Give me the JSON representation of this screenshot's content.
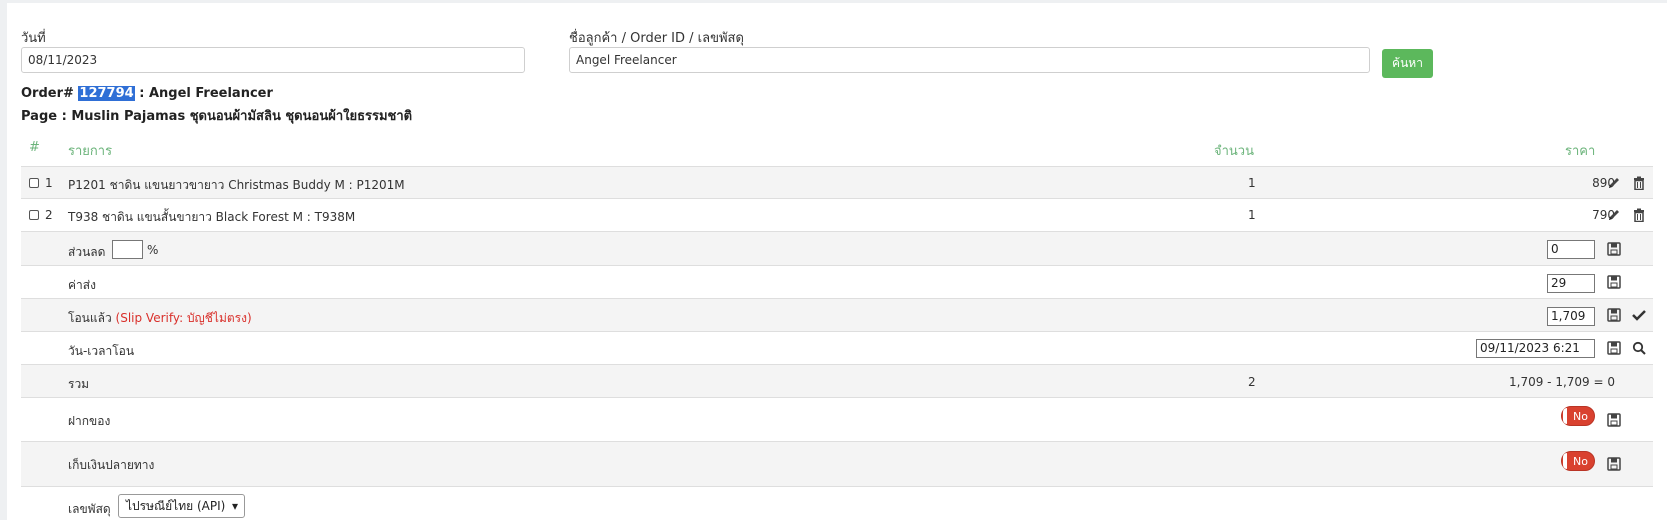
{
  "filters": {
    "date_label": "วันที่",
    "date_value": "08/11/2023",
    "customer_label": "ชื่อลูกค้า / Order ID / เลขพัสดุ",
    "customer_value": "Angel Freelancer",
    "search_button": "ค้นหา"
  },
  "order": {
    "prefix": "Order#",
    "id": "127794",
    "customer": ": Angel Freelancer",
    "page_line": "Page : Muslin Pajamas ชุดนอนผ้ามัสลิน ชุดนอนผ้าใยธรรมชาติ"
  },
  "table": {
    "headers": {
      "num": "#",
      "item": "รายการ",
      "qty": "จำนวน",
      "price": "ราคา"
    },
    "items": [
      {
        "num": "1",
        "name": "P1201 ชาดิน แขนยาวขายาว Christmas Buddy M : P1201M",
        "qty": "1",
        "price": "890"
      },
      {
        "num": "2",
        "name": "T938 ชาดิน แขนสั้นขายาว Black Forest M : T938M",
        "qty": "1",
        "price": "790"
      }
    ],
    "discount": {
      "label": "ส่วนลด",
      "percent_value": "",
      "percent_sign": "%",
      "value": "0"
    },
    "shipping": {
      "label": "ค่าส่ง",
      "value": "29"
    },
    "transfer": {
      "label": "โอนแล้ว",
      "note": "(Slip Verify: บัญชีไม่ตรง)",
      "value": "1,709"
    },
    "transfer_time": {
      "label": "วัน-เวลาโอน",
      "value": "09/11/2023 6:21"
    },
    "total": {
      "label": "รวม",
      "qty": "2",
      "summary": "1,709 - 1,709 = 0"
    },
    "deposit": {
      "label": "ฝากของ",
      "toggle": "No"
    },
    "cod": {
      "label": "เก็บเงินปลายทาง",
      "toggle": "No"
    },
    "tracking": {
      "label": "เลขพัสดุ",
      "carrier": "ไปรษณีย์ไทย (API)"
    }
  },
  "colors": {
    "accent_green": "#5cb85c",
    "header_green": "#6cb47b",
    "danger_red": "#d9302b",
    "highlight_blue": "#2f6fd6"
  }
}
